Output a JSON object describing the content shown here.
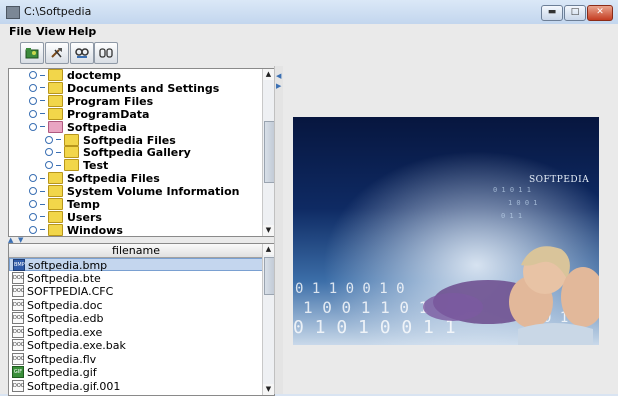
{
  "window": {
    "title": "C:\\Softpedia"
  },
  "menu": [
    "File",
    "View",
    "Help"
  ],
  "toolbar": [
    "open-folder-icon",
    "tools-icon",
    "view-icon",
    "slideshow-icon"
  ],
  "tree": {
    "items": [
      {
        "label": "doctemp",
        "level": 0,
        "open": false
      },
      {
        "label": "Documents and Settings",
        "level": 0,
        "open": false
      },
      {
        "label": "Program Files",
        "level": 0,
        "open": false
      },
      {
        "label": "ProgramData",
        "level": 0,
        "open": false
      },
      {
        "label": "Softpedia",
        "level": 0,
        "open": true
      },
      {
        "label": "Softpedia Files",
        "level": 1,
        "open": false
      },
      {
        "label": "Softpedia Gallery",
        "level": 1,
        "open": false
      },
      {
        "label": "Test",
        "level": 1,
        "open": false
      },
      {
        "label": "Softpedia Files",
        "level": 0,
        "open": false
      },
      {
        "label": "System Volume Information",
        "level": 0,
        "open": false
      },
      {
        "label": "Temp",
        "level": 0,
        "open": false
      },
      {
        "label": "Users",
        "level": 0,
        "open": false
      },
      {
        "label": "Windows",
        "level": 0,
        "open": false
      }
    ]
  },
  "filelist": {
    "header": "filename",
    "files": [
      {
        "name": "softpedia.bmp",
        "type": "bmp",
        "selected": true
      },
      {
        "name": "Softpedia.bte",
        "type": "doc",
        "selected": false
      },
      {
        "name": "SOFTPEDIA.CFC",
        "type": "doc",
        "selected": false
      },
      {
        "name": "Softpedia.doc",
        "type": "doc",
        "selected": false
      },
      {
        "name": "Softpedia.edb",
        "type": "doc",
        "selected": false
      },
      {
        "name": "Softpedia.exe",
        "type": "doc",
        "selected": false
      },
      {
        "name": "Softpedia.exe.bak",
        "type": "doc",
        "selected": false
      },
      {
        "name": "Softpedia.flv",
        "type": "doc",
        "selected": false
      },
      {
        "name": "Softpedia.gif",
        "type": "gif",
        "selected": false
      },
      {
        "name": "Softpedia.gif.001",
        "type": "doc",
        "selected": false
      }
    ]
  },
  "preview": {
    "logo_text": "SOFTPEDIA"
  }
}
